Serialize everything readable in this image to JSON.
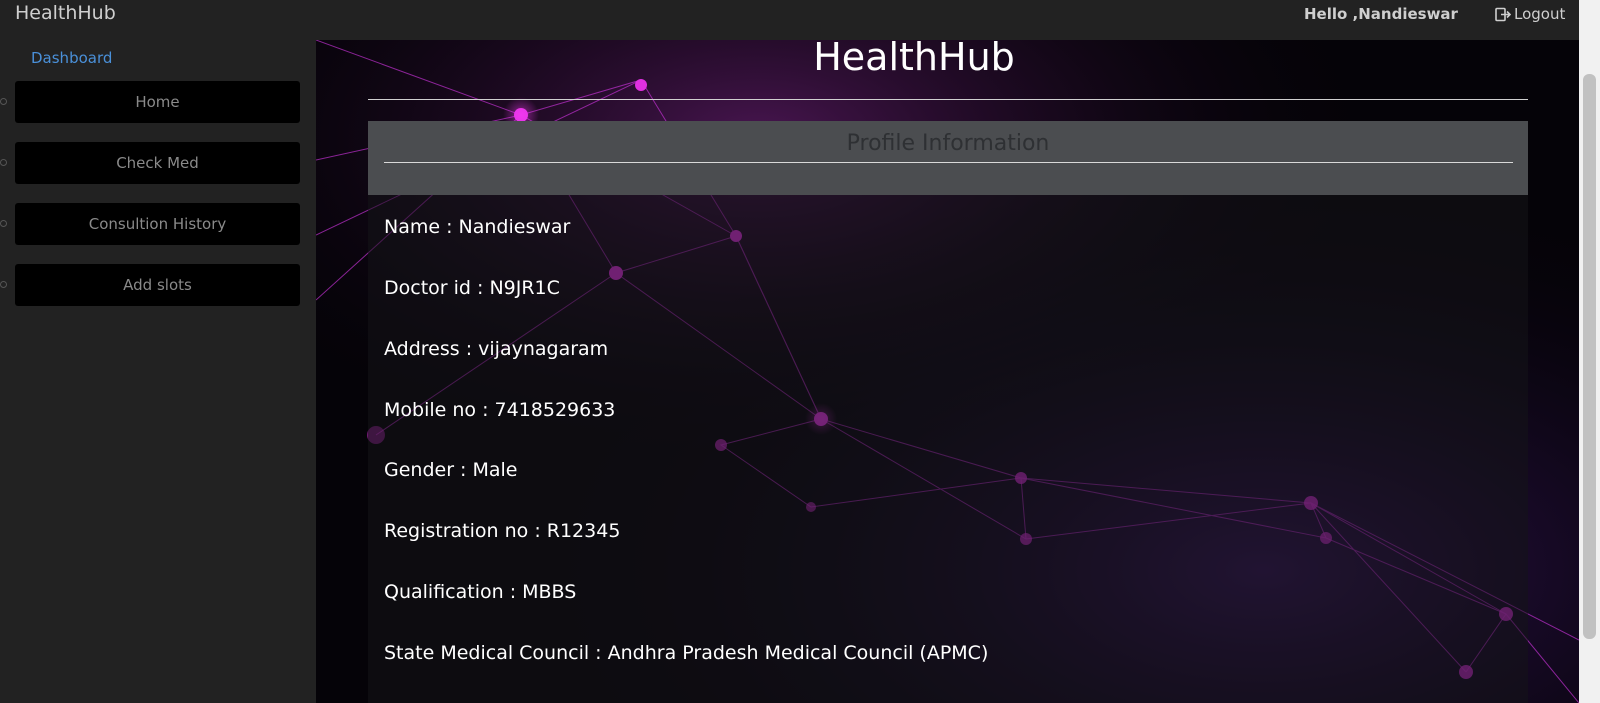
{
  "header": {
    "brand": "HealthHub",
    "greeting": "Hello ,Nandieswar",
    "logout_label": "Logout"
  },
  "sidebar": {
    "heading": "Dashboard",
    "items": [
      {
        "label": "Home"
      },
      {
        "label": "Check Med"
      },
      {
        "label": "Consultion History"
      },
      {
        "label": "Add slots"
      }
    ]
  },
  "main": {
    "title": "HealthHub",
    "card_title": "Profile Information",
    "fields": [
      "Name : Nandieswar",
      "Doctor id : N9JR1C",
      "Address : vijaynagaram",
      "Mobile no : 7418529633",
      "Gender : Male",
      "Registration no : R12345",
      "Qualification : MBBS",
      "State Medical Council : Andhra Pradesh Medical Council (APMC)"
    ]
  },
  "colors": {
    "accent_link": "#4a90d9",
    "topbar_bg": "#222222",
    "network_glow": "#e020e0"
  },
  "icons": {
    "logout": "logout-icon"
  }
}
